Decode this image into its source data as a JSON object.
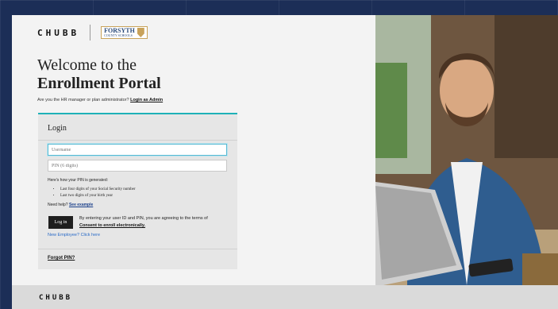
{
  "header": {
    "chubb_logo": "CHUBB",
    "partner_logo_line1": "FORSYTH",
    "partner_logo_line2": "COUNTY SCHOOLS"
  },
  "hero": {
    "welcome": "Welcome to the",
    "portal": "Enrollment Portal"
  },
  "admin": {
    "question": "Are you the HR manager or plan administrator?",
    "link": "Login as Admin"
  },
  "login": {
    "title": "Login",
    "username_placeholder": "Username",
    "pin_placeholder": "PIN (6 digits)",
    "pin_help": "Here's how your PIN is generated:",
    "pin_rules": [
      "Last four digits of your Social Security number",
      "Last two digits of your birth year"
    ],
    "need_help": "Need help?",
    "see_example": "See example",
    "button": "Log in",
    "consent_text": "By entering your user ID and PIN, you are agreeing to the terms of",
    "consent_link": "Consent to enroll electronically.",
    "new_employee": "New Employee? Click here",
    "forgot_pin": "Forgot PIN?"
  },
  "photo": {
    "subject": "smiling man in denim shirt using laptop"
  },
  "footer": {
    "chubb_logo": "CHUBB"
  }
}
